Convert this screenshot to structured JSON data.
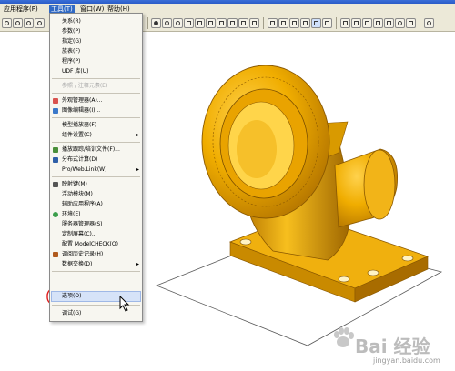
{
  "menubar": {
    "items": [
      {
        "label": "应用程序(P)"
      },
      {
        "label": "工具(T)",
        "active": true
      },
      {
        "label": "窗口(W)"
      },
      {
        "label": "帮助(H)"
      }
    ]
  },
  "dropdown": {
    "items": [
      {
        "label": "关系(R)",
        "icon": "none",
        "enabled": true
      },
      {
        "label": "参数(P)",
        "icon": "none",
        "enabled": true
      },
      {
        "label": "指定(G)",
        "icon": "none",
        "enabled": true
      },
      {
        "label": "族表(F)",
        "icon": "none",
        "enabled": true
      },
      {
        "label": "程序(P)",
        "icon": "none",
        "enabled": true
      },
      {
        "label": "UDF 库(U)",
        "icon": "none",
        "enabled": true
      },
      {
        "label": "参照 / 注释元素(E)",
        "icon": "none",
        "enabled": false
      },
      {
        "label": "外观管理器(A)...",
        "icon": "appearance-icon",
        "enabled": true
      },
      {
        "label": "图像编辑器(I)...",
        "icon": "image-editor-icon",
        "enabled": true
      },
      {
        "label": "模型播放器(F)",
        "icon": "none",
        "enabled": true
      },
      {
        "label": "组件设置(C)",
        "icon": "none",
        "enabled": true,
        "submenu": true
      },
      {
        "label": "播放跟踪/培训文件(F)...",
        "icon": "trail-icon",
        "enabled": true
      },
      {
        "label": "分布式计算(D)",
        "icon": "distributed-icon",
        "enabled": true
      },
      {
        "label": "Pro/Web.Link(W)",
        "icon": "none",
        "enabled": true,
        "submenu": true
      },
      {
        "label": "映射键(M)",
        "icon": "mapkey-icon",
        "enabled": true
      },
      {
        "label": "浮动模块(M)",
        "icon": "none",
        "enabled": true
      },
      {
        "label": "辅助应用程序(A)",
        "icon": "none",
        "enabled": true
      },
      {
        "label": "环境(E)",
        "icon": "environment-icon",
        "enabled": true
      },
      {
        "label": "服务器管理器(S)",
        "icon": "none",
        "enabled": true
      },
      {
        "label": "定制屏幕(C)...",
        "icon": "none",
        "enabled": true
      },
      {
        "label": "配置 ModelCHECK(O)",
        "icon": "none",
        "enabled": true
      },
      {
        "label": "调阅历史记录(H)",
        "icon": "history-icon",
        "enabled": true
      },
      {
        "label": "数据交换(D)",
        "icon": "none",
        "enabled": true,
        "submenu": true
      },
      {
        "label": "选项(O)",
        "icon": "none",
        "enabled": true,
        "highlighted": true
      },
      {
        "label": "调试(G)",
        "icon": "none",
        "enabled": true
      }
    ]
  },
  "toolbar": {
    "icons": [
      "display-style-icon",
      "zoom-in-icon",
      "zoom-out-icon",
      "refit-icon",
      "orient-icon",
      "saved-views-icon",
      "layers-icon",
      "view-manager-icon",
      "wireframe-icon",
      "hidden-line-icon",
      "no-hidden-icon",
      "shading-icon",
      "datum-planes-icon",
      "datum-axes-icon",
      "datum-points-icon",
      "coord-sys-icon",
      "whats-this-icon"
    ]
  },
  "watermark": {
    "text": "Bai 经验",
    "url": "jingyan.baidu.com"
  },
  "colors": {
    "model": "#e8a000",
    "model_dark": "#a86a00",
    "annotation": "#e01c1c",
    "menu_bg": "#f7f6f0",
    "chrome": "#ece9d8"
  }
}
